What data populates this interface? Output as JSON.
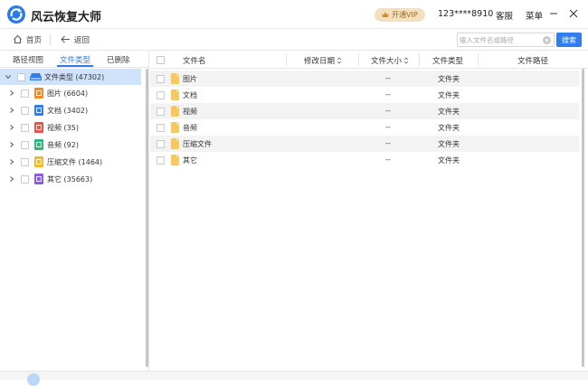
{
  "app": {
    "title": "风云恢复大师",
    "vip_label": "开通VIP",
    "user_phone": "123****8910",
    "service_label": "客服",
    "menu_label": "菜单"
  },
  "nav": {
    "home_label": "首页",
    "back_label": "返回",
    "search_placeholder": "输入文件名或路径",
    "search_button": "搜索"
  },
  "sidebar": {
    "tabs": [
      {
        "label": "路径视图",
        "active": false
      },
      {
        "label": "文件类型",
        "active": true
      },
      {
        "label": "已删除",
        "active": false
      }
    ],
    "root": {
      "label": "文件类型 (47302)"
    },
    "items": [
      {
        "label": "图片 (6604)",
        "icon": "image-file-icon",
        "color": "#f08a2c"
      },
      {
        "label": "文档 (3402)",
        "icon": "document-file-icon",
        "color": "#2f7df0"
      },
      {
        "label": "视频 (35)",
        "icon": "video-file-icon",
        "color": "#e8524a"
      },
      {
        "label": "音频 (92)",
        "icon": "audio-file-icon",
        "color": "#2fb87a"
      },
      {
        "label": "压缩文件 (1464)",
        "icon": "archive-file-icon",
        "color": "#f5b82e"
      },
      {
        "label": "其它 (35663)",
        "icon": "other-file-icon",
        "color": "#8a5ce0"
      }
    ]
  },
  "table": {
    "columns": {
      "name": "文件名",
      "modified": "修改日期",
      "size": "文件大小",
      "type": "文件类型",
      "path": "文件路径"
    },
    "rows": [
      {
        "name": "图片",
        "size": "--",
        "type": "文件夹"
      },
      {
        "name": "文档",
        "size": "--",
        "type": "文件夹"
      },
      {
        "name": "视频",
        "size": "--",
        "type": "文件夹"
      },
      {
        "name": "音频",
        "size": "--",
        "type": "文件夹"
      },
      {
        "name": "压缩文件",
        "size": "--",
        "type": "文件夹"
      },
      {
        "name": "其它",
        "size": "--",
        "type": "文件夹"
      }
    ]
  },
  "colors": {
    "accent": "#2f7df0",
    "selected_row": "#cfe3fb",
    "vip_bg": "#f3e0bf",
    "folder": "#f7c760"
  }
}
